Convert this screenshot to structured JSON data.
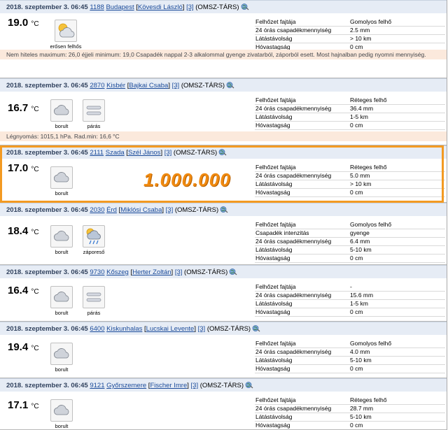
{
  "globe_icon": "globe-icon",
  "reports": [
    {
      "date": "2018. szeptember 3. 06:45",
      "zip": "1188",
      "city": "Budapest",
      "observer": "Kövesdi László",
      "count": "[3]",
      "tag": "(OMSZ-TÁRS)",
      "temp": "19.0",
      "unit": "°C",
      "icons": [
        {
          "name": "partly-cloudy-icon",
          "caption": "erősen felhős"
        }
      ],
      "props": [
        [
          "Felhőzet fajtája",
          "Gomolyos felhő"
        ],
        [
          "24 órás csapadékmennyiség",
          "2.5 mm"
        ],
        [
          "Látástávolság",
          "> 10 km"
        ],
        [
          "Hóvastagság",
          "0 cm"
        ]
      ],
      "note": "Nem hiteles maximum: 26,0 éjjeli minimum: 19,0 Csapadék nappal 2-3 alkalommal gyenge zivatarból, záporból esett. Most hajnalban pedig nyomni mennyiség."
    },
    {
      "date": "2018. szeptember 3. 06:45",
      "zip": "2870",
      "city": "Kisbér",
      "observer": "Bajkai Csaba",
      "count": "[3]",
      "tag": "(OMSZ-TÁRS)",
      "temp": "16.7",
      "unit": "°C",
      "icons": [
        {
          "name": "cloud-icon",
          "caption": "borult"
        },
        {
          "name": "fog-icon",
          "caption": "párás"
        }
      ],
      "props": [
        [
          "Felhőzet fajtája",
          "Réteges felhő"
        ],
        [
          "24 órás csapadékmennyiség",
          "36.4 mm"
        ],
        [
          "Látástávolság",
          "1-5 km"
        ],
        [
          "Hóvastagság",
          "0 cm"
        ]
      ],
      "note": "Légnyomás: 1015,1 hPa. Rad.min: 16,6 °C"
    },
    {
      "date": "2018. szeptember 3. 06:45",
      "zip": "2111",
      "city": "Szada",
      "observer": "Szél János",
      "count": "[3]",
      "tag": "(OMSZ-TÁRS)",
      "temp": "17.0",
      "unit": "°C",
      "icons": [
        {
          "name": "cloud-icon",
          "caption": "borult"
        }
      ],
      "props": [
        [
          "Felhőzet fajtája",
          "Réteges felhő"
        ],
        [
          "24 órás csapadékmennyiség",
          "5.0 mm"
        ],
        [
          "Látástávolság",
          "> 10 km"
        ],
        [
          "Hóvastagság",
          "0 cm"
        ]
      ],
      "overlay": "1.000.000"
    },
    {
      "date": "2018. szeptember 3. 06:45",
      "zip": "2030",
      "city": "Érd",
      "observer": "Miklósi Csaba",
      "count": "[3]",
      "tag": "(OMSZ-TÁRS)",
      "temp": "18.4",
      "unit": "°C",
      "icons": [
        {
          "name": "cloud-icon",
          "caption": "borult"
        },
        {
          "name": "rain-shower-icon",
          "caption": "záporeső"
        }
      ],
      "props": [
        [
          "Felhőzet fajtája",
          "Gomolyos felhő"
        ],
        [
          "Csapadék intenzitás",
          "gyenge"
        ],
        [
          "24 órás csapadékmennyiség",
          "6.4 mm"
        ],
        [
          "Látástávolság",
          "5-10 km"
        ],
        [
          "Hóvastagság",
          "0 cm"
        ]
      ]
    },
    {
      "date": "2018. szeptember 3. 06:45",
      "zip": "9730",
      "city": "Kőszeg",
      "observer": "Herter Zoltán",
      "count": "[3]",
      "tag": "(OMSZ-TÁRS)",
      "temp": "16.4",
      "unit": "°C",
      "icons": [
        {
          "name": "cloud-icon",
          "caption": "borult"
        },
        {
          "name": "fog-icon",
          "caption": "párás"
        }
      ],
      "props": [
        [
          "Felhőzet fajtája",
          "-"
        ],
        [
          "24 órás csapadékmennyiség",
          "15.6 mm"
        ],
        [
          "Látástávolság",
          "1-5 km"
        ],
        [
          "Hóvastagság",
          "0 cm"
        ]
      ]
    },
    {
      "date": "2018. szeptember 3. 06:45",
      "zip": "6400",
      "city": "Kiskunhalas",
      "observer": "Lucskai Levente",
      "count": "[3]",
      "tag": "(OMSZ-TÁRS)",
      "temp": "19.4",
      "unit": "°C",
      "icons": [
        {
          "name": "cloud-icon",
          "caption": "borult"
        }
      ],
      "props": [
        [
          "Felhőzet fajtája",
          "Gomolyos felhő"
        ],
        [
          "24 órás csapadékmennyiség",
          "4.0 mm"
        ],
        [
          "Látástávolság",
          "5-10 km"
        ],
        [
          "Hóvastagság",
          "0 cm"
        ]
      ]
    },
    {
      "date": "2018. szeptember 3. 06:45",
      "zip": "9121",
      "city": "Győrszemere",
      "observer": "Fischer Imre",
      "count": "[3]",
      "tag": "(OMSZ-TÁRS)",
      "temp": "17.1",
      "unit": "°C",
      "icons": [
        {
          "name": "cloud-icon",
          "caption": "borult"
        }
      ],
      "props": [
        [
          "Felhőzet fajtája",
          "Réteges felhő"
        ],
        [
          "24 órás csapadékmennyiség",
          "28.7 mm"
        ],
        [
          "Látástávolság",
          "5-10 km"
        ],
        [
          "Hóvastagság",
          "0 cm"
        ]
      ]
    }
  ]
}
